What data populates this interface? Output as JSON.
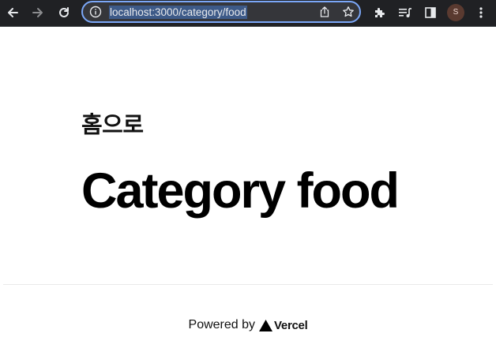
{
  "browser": {
    "url": "localhost:3000/category/food",
    "profile_initial": "S",
    "icons": [
      "back-arrow-icon",
      "forward-arrow-icon",
      "reload-icon",
      "info-icon",
      "share-icon",
      "star-icon",
      "puzzle-icon",
      "media-queue-icon",
      "side-panel-icon",
      "kebab-menu-icon"
    ]
  },
  "page": {
    "home_link": "홈으로",
    "title": "Category food"
  },
  "footer": {
    "powered_by": "Powered by",
    "brand": "Vercel"
  },
  "colors": {
    "toolbar_bg": "#202124",
    "omnibox_border": "#7ba7f7",
    "url_highlight": "#3d5a88",
    "page_bg": "#ffffff",
    "text": "#000000"
  }
}
